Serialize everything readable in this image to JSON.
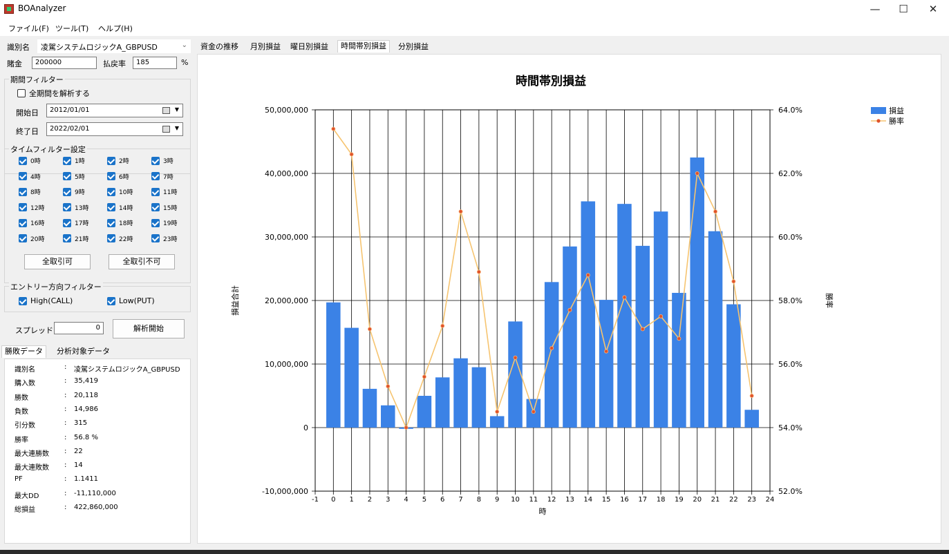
{
  "window": {
    "title": "BOAnalyzer",
    "minimize": "—",
    "maximize": "☐",
    "close": "✕"
  },
  "menu": [
    "ファイル(F)",
    "ツール(T)",
    "ヘルプ(H)"
  ],
  "form": {
    "logic_label": "識別名",
    "logic_value": "凌駕システムロジックA_GBPUSD",
    "stake_label": "賭金",
    "stake_value": "200000",
    "payout_label": "払戻率",
    "payout_value": "185",
    "payout_unit": "%"
  },
  "period_filter": {
    "title": "期間フィルター",
    "all_period_label": "全期間を解析する",
    "all_period_checked": false,
    "start_label": "開始日",
    "start_value": "2012/01/01",
    "end_label": "終了日",
    "end_value": "2022/02/01"
  },
  "time_filter": {
    "title": "タイムフィルター設定",
    "hours": [
      "0時",
      "1時",
      "2時",
      "3時",
      "4時",
      "5時",
      "6時",
      "7時",
      "8時",
      "9時",
      "10時",
      "11時",
      "12時",
      "13時",
      "14時",
      "15時",
      "16時",
      "17時",
      "18時",
      "19時",
      "20時",
      "21時",
      "22時",
      "23時"
    ],
    "allow_all": "全取引可",
    "deny_all": "全取引不可"
  },
  "entry_filter": {
    "title": "エントリー方向フィルター",
    "high": "High(CALL)",
    "low": "Low(PUT)"
  },
  "spread": {
    "label": "スプレッド",
    "value": "0",
    "run_button": "解析開始"
  },
  "left_tabs": [
    "勝敗データ",
    "分析対象データ"
  ],
  "stats": [
    {
      "k": "識別名",
      "v": "凌駕システムロジックA_GBPUSD"
    },
    {
      "k": "購入数",
      "v": "35,419"
    },
    {
      "k": "勝数",
      "v": "20,118"
    },
    {
      "k": "負数",
      "v": "14,986"
    },
    {
      "k": "引分数",
      "v": "315"
    },
    {
      "k": "勝率",
      "v": "56.8 %"
    },
    {
      "k": "最大連勝数",
      "v": "22"
    },
    {
      "k": "最大連敗数",
      "v": "14"
    },
    {
      "k": "PF",
      "v": "1.1411"
    },
    {
      "k": "最大DD",
      "v": "-11,110,000"
    },
    {
      "k": "総損益",
      "v": "422,860,000"
    }
  ],
  "stat_colon": ":",
  "chart_tabs": [
    "資金の推移",
    "月別損益",
    "曜日別損益",
    "時間帯別損益",
    "分別損益"
  ],
  "active_chart_tab": 3,
  "colors": {
    "bar": "#3b82e6",
    "line": "#f6c470",
    "marker": "#e0522a",
    "accent": "#1a73c9"
  },
  "chart_data": {
    "type": "bar",
    "title": "時間帯別損益",
    "xlabel": "時",
    "ylabel": "損益合計",
    "y2label": "勝率",
    "xlim": [
      -1,
      24
    ],
    "ylim": [
      -10000000,
      50000000
    ],
    "y2lim": [
      52.0,
      64.0
    ],
    "grid": true,
    "legend_position": "top-right",
    "x_ticks": [
      "-1",
      "0",
      "1",
      "2",
      "3",
      "4",
      "5",
      "6",
      "7",
      "8",
      "9",
      "10",
      "11",
      "12",
      "13",
      "14",
      "15",
      "16",
      "17",
      "18",
      "19",
      "20",
      "21",
      "22",
      "23",
      "24"
    ],
    "y_ticks": [
      "-10,000,000",
      "0",
      "10,000,000",
      "20,000,000",
      "30,000,000",
      "40,000,000",
      "50,000,000"
    ],
    "y2_ticks": [
      "52.0%",
      "54.0%",
      "56.0%",
      "58.0%",
      "60.0%",
      "62.0%",
      "64.0%"
    ],
    "x": [
      0,
      1,
      2,
      3,
      4,
      5,
      6,
      7,
      8,
      9,
      10,
      11,
      12,
      13,
      14,
      15,
      16,
      17,
      18,
      19,
      20,
      21,
      22,
      23
    ],
    "series": [
      {
        "name": "損益",
        "type": "bar",
        "axis": "left",
        "values": [
          19700000,
          15700000,
          6100000,
          3500000,
          -200000,
          5000000,
          7900000,
          10900000,
          9500000,
          1800000,
          16700000,
          4500000,
          22900000,
          28500000,
          35600000,
          20100000,
          35200000,
          28600000,
          34000000,
          21200000,
          42500000,
          30900000,
          19400000,
          2800000
        ]
      },
      {
        "name": "勝率",
        "type": "line",
        "axis": "right",
        "values": [
          63.4,
          62.6,
          57.1,
          55.3,
          54.0,
          55.6,
          57.2,
          60.8,
          58.9,
          54.5,
          56.2,
          54.5,
          56.5,
          57.7,
          58.8,
          56.4,
          58.1,
          57.1,
          57.5,
          56.8,
          62.0,
          60.8,
          58.6,
          55.0
        ]
      }
    ]
  }
}
